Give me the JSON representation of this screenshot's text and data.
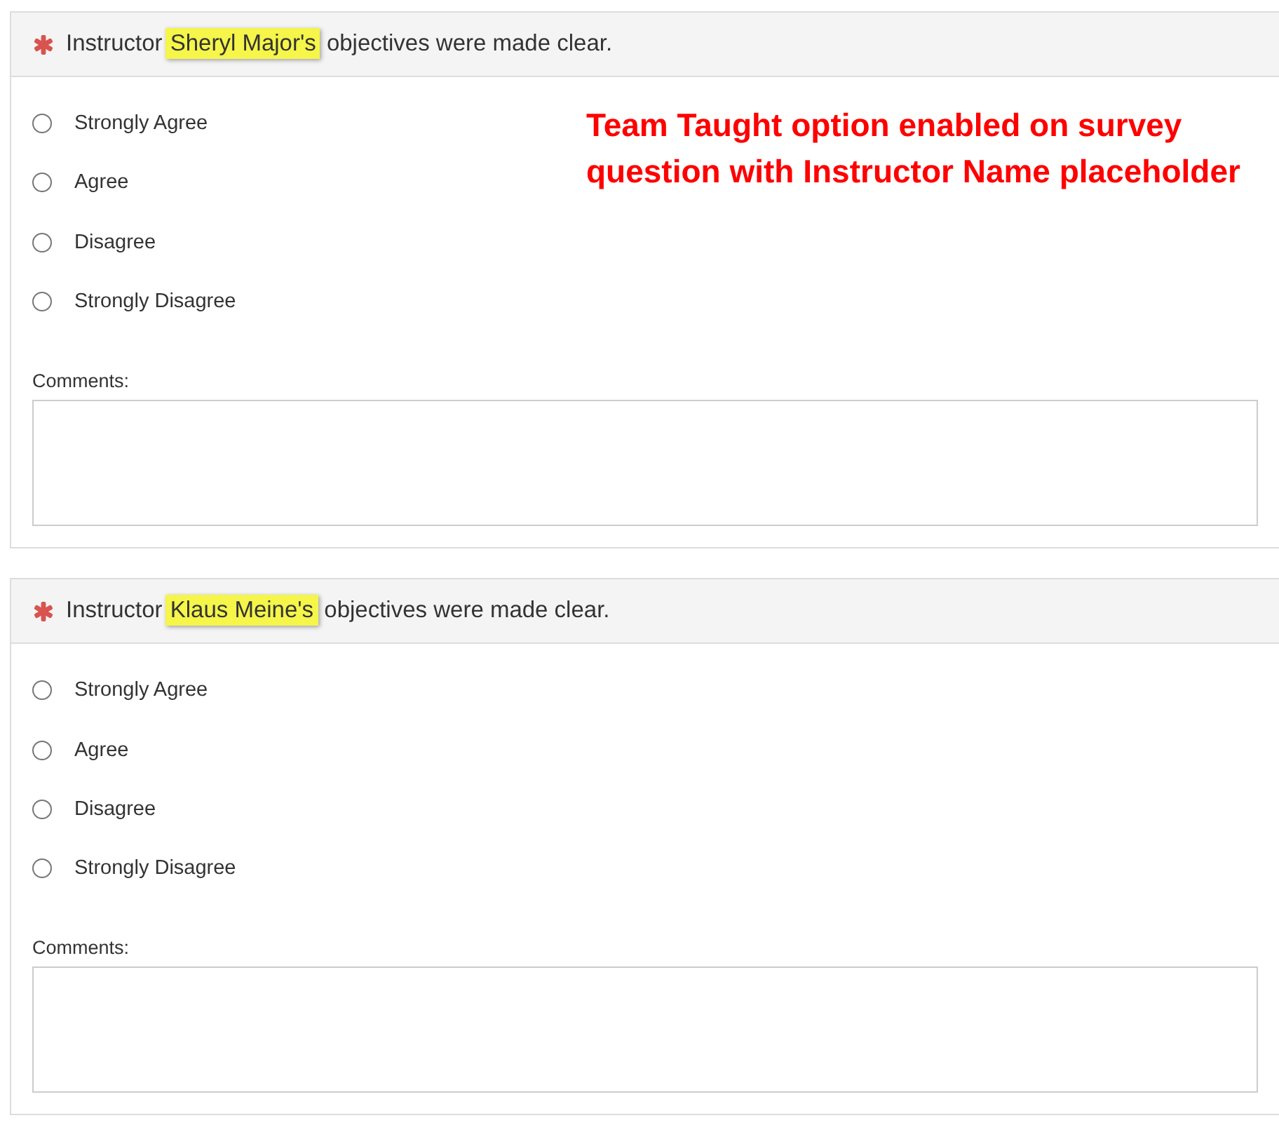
{
  "questions": [
    {
      "required": true,
      "prefix": "Instructor ",
      "name": "Sheryl Major's",
      "suffix": " objectives were made clear.",
      "options": [
        {
          "label": "Strongly Agree",
          "selected": false
        },
        {
          "label": "Agree",
          "selected": false
        },
        {
          "label": "Disagree",
          "selected": false
        },
        {
          "label": "Strongly Disagree",
          "selected": false
        }
      ],
      "comments_label": "Comments:",
      "annotation": {
        "lines": [
          "Team Taught option enabled on survey",
          "question with Instructor Name placeholder"
        ]
      }
    },
    {
      "required": true,
      "prefix": "Instructor ",
      "name": "Klaus Meine's",
      "suffix": " objectives were made clear.",
      "options": [
        {
          "label": "Strongly Agree",
          "selected": false
        },
        {
          "label": "Agree",
          "selected": false
        },
        {
          "label": "Disagree",
          "selected": false
        },
        {
          "label": "Strongly Disagree",
          "selected": false
        }
      ],
      "comments_label": "Comments:"
    }
  ]
}
